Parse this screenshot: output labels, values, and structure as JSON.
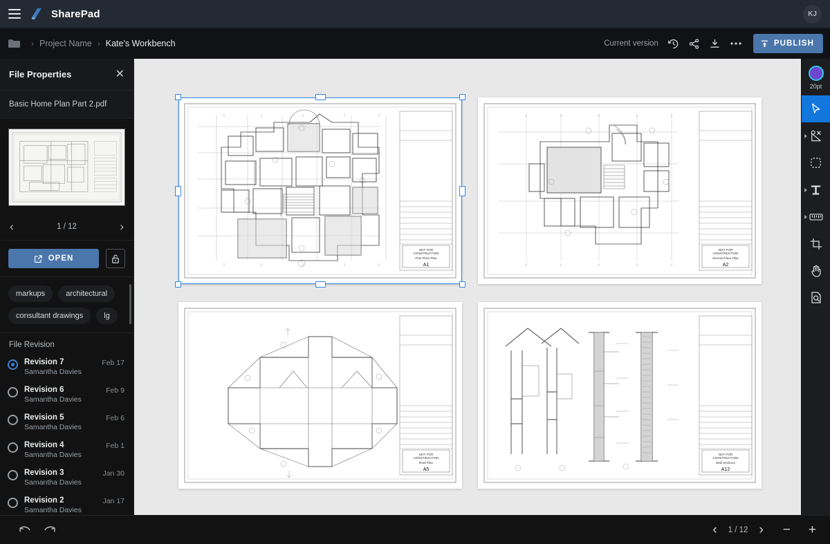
{
  "topbar": {
    "menu_icon": "hamburger-menu-icon",
    "logo_icon": "sharepad-logo-icon",
    "app_title": "SharePad",
    "avatar_initials": "KJ"
  },
  "breadcrumb": {
    "folder_icon": "folder-icon",
    "separator": "›",
    "items": [
      {
        "label": "Project Name",
        "current": false
      },
      {
        "label": "Kate's Workbench",
        "current": true
      }
    ],
    "version_label": "Current version",
    "history_icon": "history-clock-icon",
    "share_icon": "share-icon",
    "download_icon": "download-icon",
    "more_icon": "more-horizontal-icon",
    "publish_label": "PUBLISH",
    "publish_icon": "publish-upload-icon",
    "publish_color": "#4a76ab"
  },
  "file_properties": {
    "title": "File Properties",
    "close_icon": "close-icon",
    "file_name": "Basic Home Plan Part 2.pdf",
    "thumbnail_name": "page-thumbnail",
    "pager": {
      "prev_icon": "chevron-left-icon",
      "next_icon": "chevron-right-icon",
      "label": "1 / 12",
      "current": 1,
      "total": 12
    },
    "open_label": "OPEN",
    "open_icon": "open-external-icon",
    "lock_icon": "unlocked-padlock-icon",
    "tags": [
      "markups",
      "architectural",
      "consultant drawings",
      "lg"
    ],
    "revision_header": "File Revision",
    "revisions": [
      {
        "name": "Revision 7",
        "author": "Samantha Davies",
        "date": "Feb 17",
        "selected": true
      },
      {
        "name": "Revision 6",
        "author": "Samantha Davies",
        "date": "Feb 9",
        "selected": false
      },
      {
        "name": "Revision 5",
        "author": "Samantha Davies",
        "date": "Feb 6",
        "selected": false
      },
      {
        "name": "Revision 4",
        "author": "Samantha Davies",
        "date": "Feb 1",
        "selected": false
      },
      {
        "name": "Revision 3",
        "author": "Samantha Davies",
        "date": "Jan 30",
        "selected": false
      },
      {
        "name": "Revision 2",
        "author": "Samantha Davies",
        "date": "Jan 17",
        "selected": false
      }
    ]
  },
  "canvas": {
    "background_color": "#e8e8e8",
    "selection_color": "#2f84e0",
    "pages": [
      {
        "sheet_number": "A1",
        "sheet_title": "First Floor Plan",
        "stamp": "NOT FOR CONSTRUCTION",
        "selected": true,
        "drawing_type": "floor-plan"
      },
      {
        "sheet_number": "A2",
        "sheet_title": "Second Floor Plan",
        "stamp": "NOT FOR CONSTRUCTION",
        "selected": false,
        "drawing_type": "floor-plan"
      },
      {
        "sheet_number": "A5",
        "sheet_title": "Roof Plan",
        "stamp": "NOT FOR CONSTRUCTION",
        "selected": false,
        "drawing_type": "roof-plan"
      },
      {
        "sheet_number": "A12",
        "sheet_title": "Wall Sections",
        "stamp": "NOT FOR CONSTRUCTION",
        "selected": false,
        "drawing_type": "wall-sections"
      }
    ]
  },
  "toolbar": {
    "swatch_color": "#6f45d1",
    "swatch_ring_color": "#2ec9e8",
    "swatch_label": "20pt",
    "active_color": "#1277dd",
    "tools": [
      {
        "icon": "cursor-arrow-icon",
        "active": true,
        "has_submenu": false
      },
      {
        "icon": "shape-tools-icon",
        "active": false,
        "has_submenu": true
      },
      {
        "icon": "lasso-select-icon",
        "active": false,
        "has_submenu": false
      },
      {
        "icon": "text-tool-icon",
        "active": false,
        "has_submenu": true
      },
      {
        "icon": "measure-ruler-icon",
        "active": false,
        "has_submenu": true
      },
      {
        "icon": "crop-icon",
        "active": false,
        "has_submenu": false
      },
      {
        "icon": "hand-pan-icon",
        "active": false,
        "has_submenu": false
      },
      {
        "icon": "document-search-icon",
        "active": false,
        "has_submenu": false
      }
    ]
  },
  "bottombar": {
    "undo_icon": "undo-icon",
    "redo_icon": "redo-icon",
    "prev_icon": "chevron-left-icon",
    "next_icon": "chevron-right-icon",
    "page_label": "1 / 12",
    "zoom_out_label": "−",
    "zoom_in_label": "+"
  }
}
